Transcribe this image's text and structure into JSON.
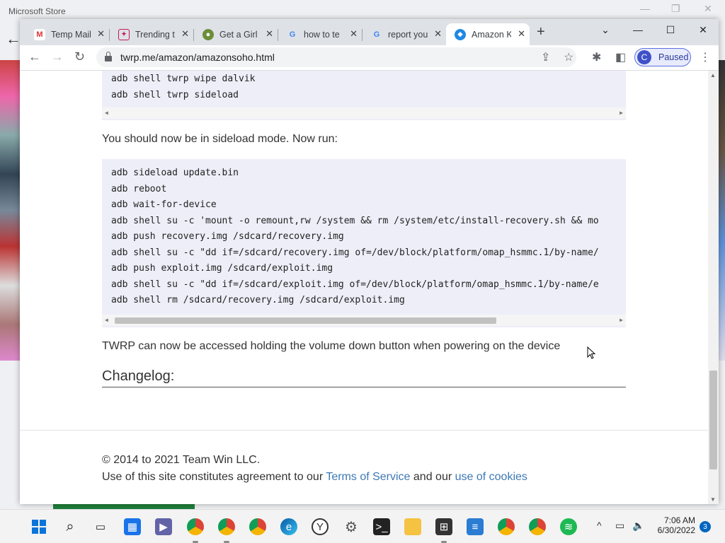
{
  "background_app": {
    "title": "Microsoft Store"
  },
  "tabs": [
    {
      "title": "Temp Mail",
      "icon": "gmail-icon",
      "active": false
    },
    {
      "title": "Trending t",
      "icon": "trending-icon",
      "active": false
    },
    {
      "title": "Get a Girl",
      "icon": "site-icon",
      "active": false
    },
    {
      "title": "how to te",
      "icon": "google-icon",
      "active": false
    },
    {
      "title": "report you",
      "icon": "google-icon",
      "active": false
    },
    {
      "title": "Amazon K",
      "icon": "twrp-icon",
      "active": true
    }
  ],
  "address_bar": {
    "url": "twrp.me/amazon/amazonsoho.html"
  },
  "profile": {
    "initial": "C",
    "status": "Paused"
  },
  "page": {
    "code_block_1": [
      "adb shell twrp wipe dalvik",
      "adb shell twrp sideload"
    ],
    "paragraph_sideload": "You should now be in sideload mode. Now run:",
    "code_block_2": [
      "adb sideload update.bin",
      "adb reboot",
      "adb wait-for-device",
      "adb shell su -c 'mount -o remount,rw /system && rm /system/etc/install-recovery.sh && mo",
      "adb push recovery.img /sdcard/recovery.img",
      "adb shell su -c \"dd if=/sdcard/recovery.img of=/dev/block/platform/omap_hsmmc.1/by-name/",
      "adb push exploit.img /sdcard/exploit.img",
      "adb shell su -c \"dd if=/sdcard/exploit.img of=/dev/block/platform/omap_hsmmc.1/by-name/e",
      "adb shell rm /sdcard/recovery.img /sdcard/exploit.img"
    ],
    "paragraph_access": "TWRP can now be accessed holding the volume down button when powering on the device",
    "changelog_heading": "Changelog:",
    "footer": {
      "copyright": "© 2014 to 2021 Team Win LLC.",
      "agreement_prefix": "Use of this site constitutes agreement to our",
      "terms_link": "Terms of Service",
      "and_text": "and our",
      "cookies_link": "use of cookies"
    }
  },
  "taskbar": {
    "clock_time": "7:06 AM",
    "clock_date": "6/30/2022",
    "notification_count": "3"
  },
  "colors": {
    "link": "#3d78b5",
    "code_bg": "#eeeef9",
    "accent": "#3f51c8"
  }
}
